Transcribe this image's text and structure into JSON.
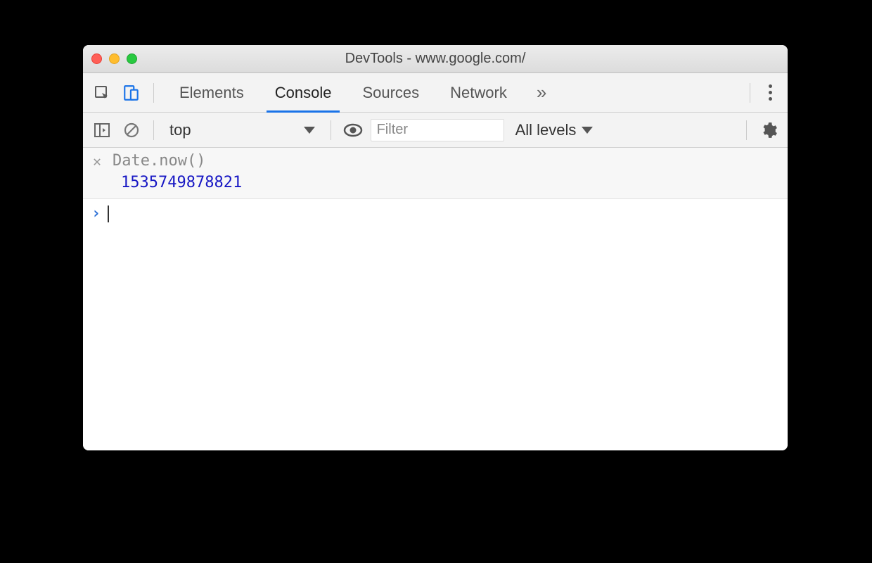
{
  "window": {
    "title": "DevTools - www.google.com/"
  },
  "tabs": {
    "items": [
      "Elements",
      "Console",
      "Sources",
      "Network"
    ],
    "active_index": 1
  },
  "toolbar": {
    "context": "top",
    "filter_placeholder": "Filter",
    "levels_label": "All levels"
  },
  "console": {
    "history": [
      {
        "expression": "Date.now()",
        "result": "1535749878821"
      }
    ]
  }
}
